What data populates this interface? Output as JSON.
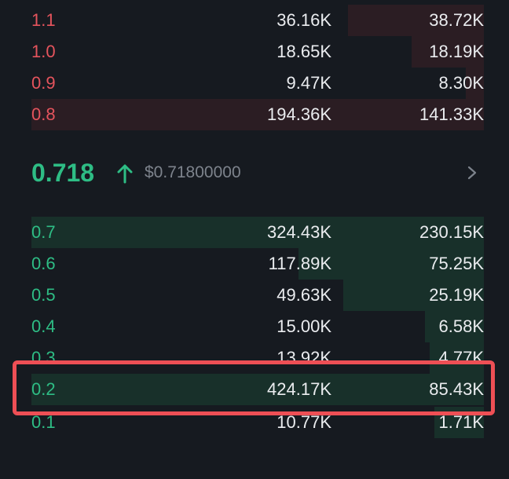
{
  "asks": [
    {
      "price": "1.1",
      "amount": "36.16K",
      "total": "38.72K",
      "depth": 0.3
    },
    {
      "price": "1.0",
      "amount": "18.65K",
      "total": "18.19K",
      "depth": 0.16
    },
    {
      "price": "0.9",
      "amount": "9.47K",
      "total": "8.30K",
      "depth": 0.04
    },
    {
      "price": "0.8",
      "amount": "194.36K",
      "total": "141.33K",
      "depth": 1.0
    }
  ],
  "mid": {
    "price": "0.718",
    "usd": "$0.71800000",
    "direction_icon": "arrow-up-icon",
    "detail_icon": "chevron-right-icon"
  },
  "bids": [
    {
      "price": "0.7",
      "amount": "324.43K",
      "total": "230.15K",
      "depth": 1.0
    },
    {
      "price": "0.6",
      "amount": "117.89K",
      "total": "75.25K",
      "depth": 0.41
    },
    {
      "price": "0.5",
      "amount": "49.63K",
      "total": "25.19K",
      "depth": 0.31
    },
    {
      "price": "0.4",
      "amount": "15.00K",
      "total": "6.58K",
      "depth": 0.13
    },
    {
      "price": "0.3",
      "amount": "13.92K",
      "total": "4.77K",
      "depth": 0.12
    },
    {
      "price": "0.2",
      "amount": "424.17K",
      "total": "85.43K",
      "depth": 1.0
    },
    {
      "price": "0.1",
      "amount": "10.77K",
      "total": "1.71K",
      "depth": 0.11
    }
  ],
  "colors": {
    "ask": "#e5545d",
    "bid": "#2ebd85",
    "highlight": "#ee4f55"
  }
}
